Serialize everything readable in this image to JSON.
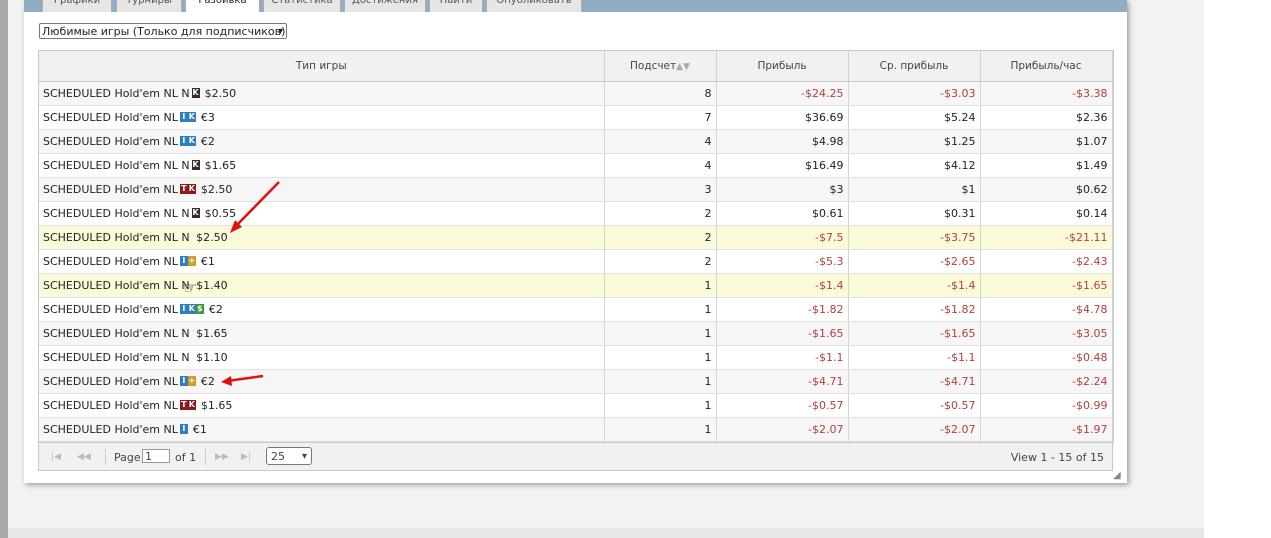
{
  "tabs": [
    "Графики",
    "Турниры",
    "Разбивка",
    "Статистика",
    "Достижения",
    "Найти",
    "Опубликовать"
  ],
  "active_tab": 2,
  "filter": {
    "value": "Любимые игры (Только для подписчиков)"
  },
  "table": {
    "headers": [
      "Тип игры",
      "Подсчет",
      "Прибыль",
      "Ср. прибыль",
      "Прибыль/час"
    ],
    "rows": [
      {
        "name": "SCHEDULED Hold'em NL N",
        "icon": "k",
        "stake": "$2.50",
        "count": "8",
        "profit": "-$24.25",
        "avg": "-$3.03",
        "hour": "-$3.38"
      },
      {
        "name": "SCHEDULED Hold'em NL",
        "icon": "ik",
        "stake": "€3",
        "count": "7",
        "profit": "$36.69",
        "avg": "$5.24",
        "hour": "$2.36"
      },
      {
        "name": "SCHEDULED Hold'em NL",
        "icon": "ik",
        "stake": "€2",
        "count": "4",
        "profit": "$4.98",
        "avg": "$1.25",
        "hour": "$1.07"
      },
      {
        "name": "SCHEDULED Hold'em NL N",
        "icon": "k",
        "stake": "$1.65",
        "count": "4",
        "profit": "$16.49",
        "avg": "$4.12",
        "hour": "$1.49"
      },
      {
        "name": "SCHEDULED Hold'em NL",
        "icon": "tk",
        "stake": "$2.50",
        "count": "3",
        "profit": "$3",
        "avg": "$1",
        "hour": "$0.62"
      },
      {
        "name": "SCHEDULED Hold'em NL N",
        "icon": "k",
        "stake": "$0.55",
        "count": "2",
        "profit": "$0.61",
        "avg": "$0.31",
        "hour": "$0.14"
      },
      {
        "name": "SCHEDULED Hold'em NL N",
        "icon": "",
        "stake": "$2.50",
        "count": "2",
        "profit": "-$7.5",
        "avg": "-$3.75",
        "hour": "-$21.11"
      },
      {
        "name": "SCHEDULED Hold'em NL",
        "icon": "iplus",
        "stake": "€1",
        "count": "2",
        "profit": "-$5.3",
        "avg": "-$2.65",
        "hour": "-$2.43"
      },
      {
        "name": "SCHEDULED Hold'em NL N",
        "icon": "",
        "stake": "$1.40",
        "count": "1",
        "profit": "-$1.4",
        "avg": "-$1.4",
        "hour": "-$1.65"
      },
      {
        "name": "SCHEDULED Hold'em NL",
        "icon": "iks",
        "stake": "€2",
        "count": "1",
        "profit": "-$1.82",
        "avg": "-$1.82",
        "hour": "-$4.78"
      },
      {
        "name": "SCHEDULED Hold'em NL N",
        "icon": "",
        "stake": "$1.65",
        "count": "1",
        "profit": "-$1.65",
        "avg": "-$1.65",
        "hour": "-$3.05"
      },
      {
        "name": "SCHEDULED Hold'em NL N",
        "icon": "",
        "stake": "$1.10",
        "count": "1",
        "profit": "-$1.1",
        "avg": "-$1.1",
        "hour": "-$0.48"
      },
      {
        "name": "SCHEDULED Hold'em NL",
        "icon": "iplus",
        "stake": "€2",
        "count": "1",
        "profit": "-$4.71",
        "avg": "-$4.71",
        "hour": "-$2.24"
      },
      {
        "name": "SCHEDULED Hold'em NL",
        "icon": "tk",
        "stake": "$1.65",
        "count": "1",
        "profit": "-$0.57",
        "avg": "-$0.57",
        "hour": "-$0.99"
      },
      {
        "name": "SCHEDULED Hold'em NL",
        "icon": "i",
        "stake": "€1",
        "count": "1",
        "profit": "-$2.07",
        "avg": "-$2.07",
        "hour": "-$1.97"
      }
    ],
    "highlight_rows": [
      6,
      8
    ]
  },
  "pager": {
    "page_label": "Page",
    "page_value": "1",
    "of_label": "of 1",
    "rows_per_page": "25",
    "view_label": "View 1 - 15 of 15"
  },
  "colors": {
    "negative": "#b04040",
    "positive": "#222222",
    "highlight": "#fbfbdc",
    "annotation": "#e01010"
  }
}
